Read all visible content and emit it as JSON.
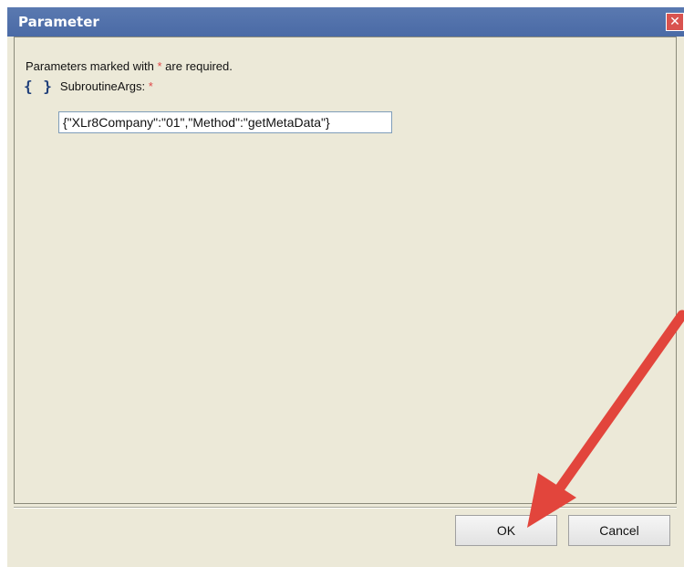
{
  "dialog": {
    "title": "Parameter",
    "close_symbol": "✕"
  },
  "form": {
    "required_note_prefix": "Parameters marked with ",
    "required_star": "*",
    "required_note_suffix": " are required.",
    "param_icon": "{ }",
    "param_label": "SubroutineArgs:",
    "param_value": "{\"XLr8Company\":\"01\",\"Method\":\"getMetaData\"}"
  },
  "buttons": {
    "ok_label": "OK",
    "cancel_label": "Cancel"
  },
  "colors": {
    "titlebar": "#4a6aa6",
    "dialog_bg": "#ece9d8",
    "required_star": "#e04848",
    "annotation_arrow": "#e2453c"
  }
}
